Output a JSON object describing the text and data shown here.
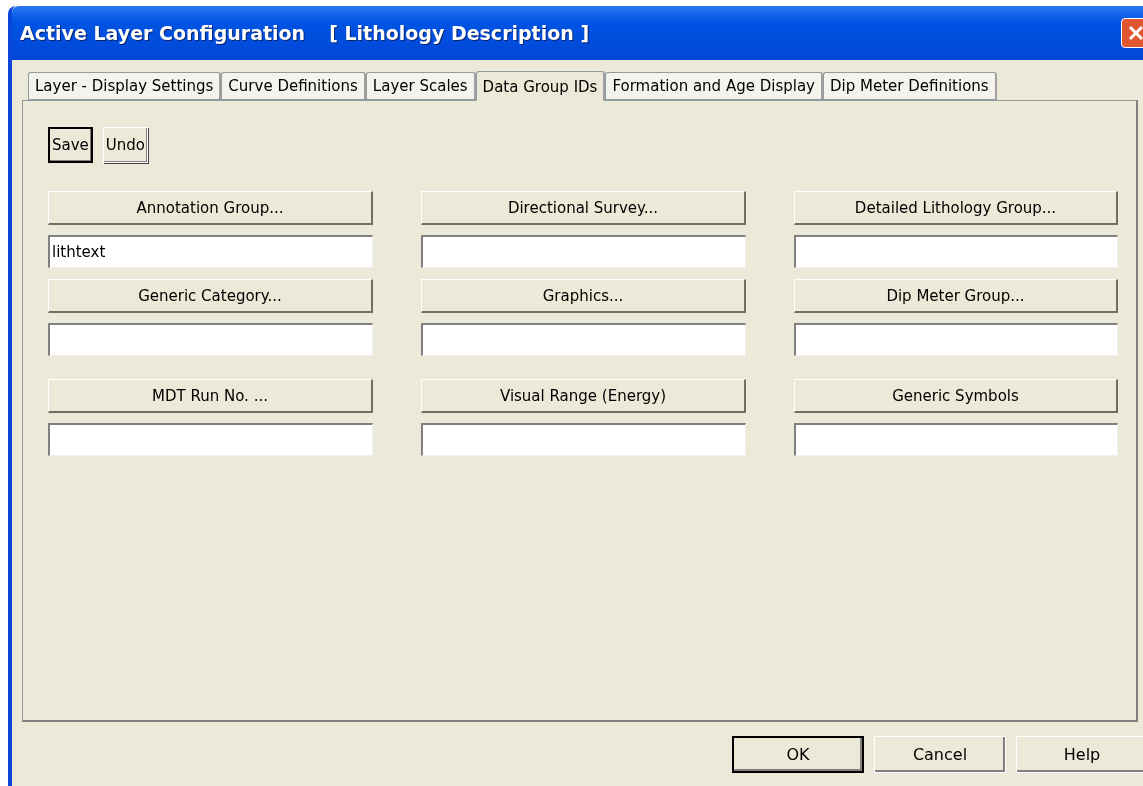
{
  "window": {
    "title": "Active Layer Configuration",
    "subtitle": "[ Lithology Description ]"
  },
  "tabs": [
    {
      "label": "Layer - Display Settings",
      "selected": false
    },
    {
      "label": "Curve Definitions",
      "selected": false
    },
    {
      "label": "Layer Scales",
      "selected": false
    },
    {
      "label": "Data Group IDs",
      "selected": true
    },
    {
      "label": "Formation and Age Display",
      "selected": false
    },
    {
      "label": "Dip Meter Definitions",
      "selected": false
    }
  ],
  "toolbar": [
    {
      "label": "Save",
      "default": true
    },
    {
      "label": "Undo",
      "default": false
    }
  ],
  "groups": [
    {
      "label": "Annotation Group...",
      "value": "lithtext"
    },
    {
      "label": "Directional Survey..."
    },
    {
      "label": "Detailed Lithology Group..."
    },
    {
      "label": "Generic Category..."
    },
    {
      "label": "Graphics..."
    },
    {
      "label": "Dip Meter Group..."
    },
    {
      "label": "MDT Run No. ..."
    },
    {
      "label": "Visual Range (Energy)"
    },
    {
      "label": "Generic Symbols"
    }
  ],
  "buttons": [
    {
      "label": "OK",
      "default": true
    },
    {
      "label": "Cancel",
      "default": false
    },
    {
      "label": "Help",
      "default": false
    }
  ]
}
